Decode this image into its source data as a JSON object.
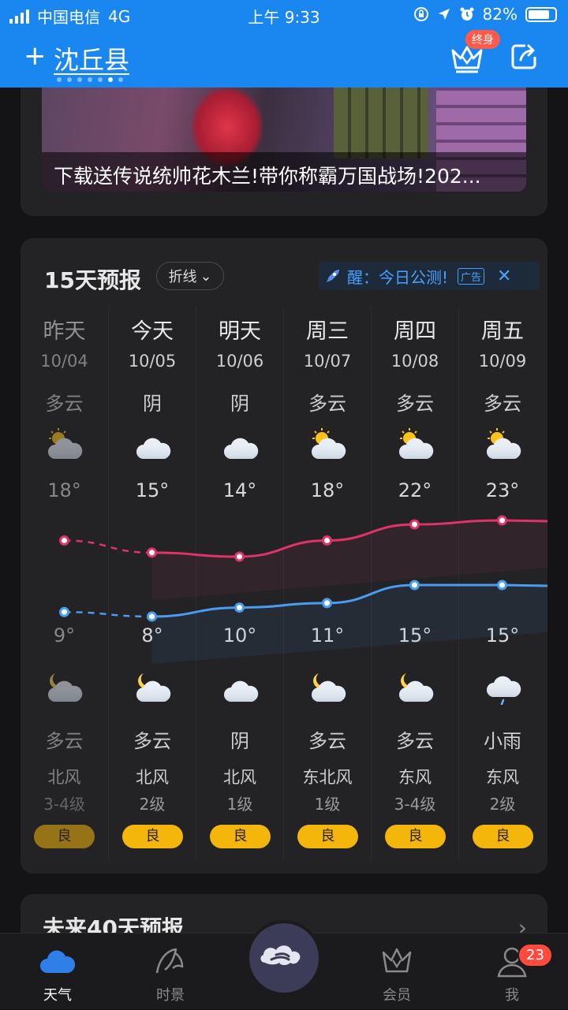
{
  "status_bar": {
    "carrier": "中国电信",
    "network": "4G",
    "time": "上午 9:33",
    "battery": "82%",
    "battery_level": 0.82
  },
  "header": {
    "add": "+",
    "city": "沈丘县",
    "vip_badge": "终身",
    "page_count": 7,
    "current_page": 6
  },
  "ad_banner": {
    "title": "下载送传说统帅花木兰!带你称霸万国战场!202..."
  },
  "forecast": {
    "title": "15天预报",
    "mode": "折线",
    "ad_text": "醒：今日公测!",
    "ad_tag": "广告",
    "ad_close": "✕",
    "days": [
      {
        "day": "昨天",
        "date": "10/04",
        "cond_day": "多云",
        "icon_day": "partly-cloudy-day-icon",
        "hi": "18°",
        "hi_val": 18,
        "lo": "9°",
        "lo_val": 9,
        "icon_night": "partly-cloudy-night-icon",
        "cond_night": "多云",
        "wind": "北风",
        "level": "3-4级",
        "aqi": "良",
        "past": true
      },
      {
        "day": "今天",
        "date": "10/05",
        "cond_day": "阴",
        "icon_day": "cloudy-icon",
        "hi": "15°",
        "hi_val": 15,
        "lo": "8°",
        "lo_val": 8,
        "icon_night": "partly-cloudy-night-icon",
        "cond_night": "多云",
        "wind": "北风",
        "level": "2级",
        "aqi": "良",
        "past": false
      },
      {
        "day": "明天",
        "date": "10/06",
        "cond_day": "阴",
        "icon_day": "cloudy-icon",
        "hi": "14°",
        "hi_val": 14,
        "lo": "10°",
        "lo_val": 10,
        "icon_night": "cloudy-icon",
        "cond_night": "阴",
        "wind": "北风",
        "level": "1级",
        "aqi": "良",
        "past": false
      },
      {
        "day": "周三",
        "date": "10/07",
        "cond_day": "多云",
        "icon_day": "partly-cloudy-day-icon",
        "hi": "18°",
        "hi_val": 18,
        "lo": "11°",
        "lo_val": 11,
        "icon_night": "partly-cloudy-night-icon",
        "cond_night": "多云",
        "wind": "东北风",
        "level": "1级",
        "aqi": "良",
        "past": false
      },
      {
        "day": "周四",
        "date": "10/08",
        "cond_day": "多云",
        "icon_day": "partly-cloudy-day-icon",
        "hi": "22°",
        "hi_val": 22,
        "lo": "15°",
        "lo_val": 15,
        "icon_night": "partly-cloudy-night-icon",
        "cond_night": "多云",
        "wind": "东风",
        "level": "3-4级",
        "aqi": "良",
        "past": false
      },
      {
        "day": "周五",
        "date": "10/09",
        "cond_day": "多云",
        "icon_day": "partly-cloudy-day-icon",
        "hi": "23°",
        "hi_val": 23,
        "lo": "15°",
        "lo_val": 15,
        "icon_night": "light-rain-icon",
        "cond_night": "小雨",
        "wind": "东风",
        "level": "2级",
        "aqi": "良",
        "past": false
      }
    ]
  },
  "next_section": {
    "title": "未来40天预报",
    "arrow": "›"
  },
  "tab_bar": {
    "tabs": [
      {
        "label": "天气",
        "icon": "weather-cloud-icon",
        "active": true
      },
      {
        "label": "时景",
        "icon": "scenery-icon",
        "active": false
      },
      {
        "label": "",
        "icon": "cloud-center-icon",
        "active": false
      },
      {
        "label": "会员",
        "icon": "crown-icon",
        "active": false
      },
      {
        "label": "我",
        "icon": "user-icon",
        "active": false
      }
    ],
    "me_badge": "23"
  },
  "colors": {
    "brand": "#1a87f1",
    "hi_line": "#e0336a",
    "lo_line": "#4a9cf0",
    "aqi": "#f5b60b",
    "card": "#232326"
  }
}
